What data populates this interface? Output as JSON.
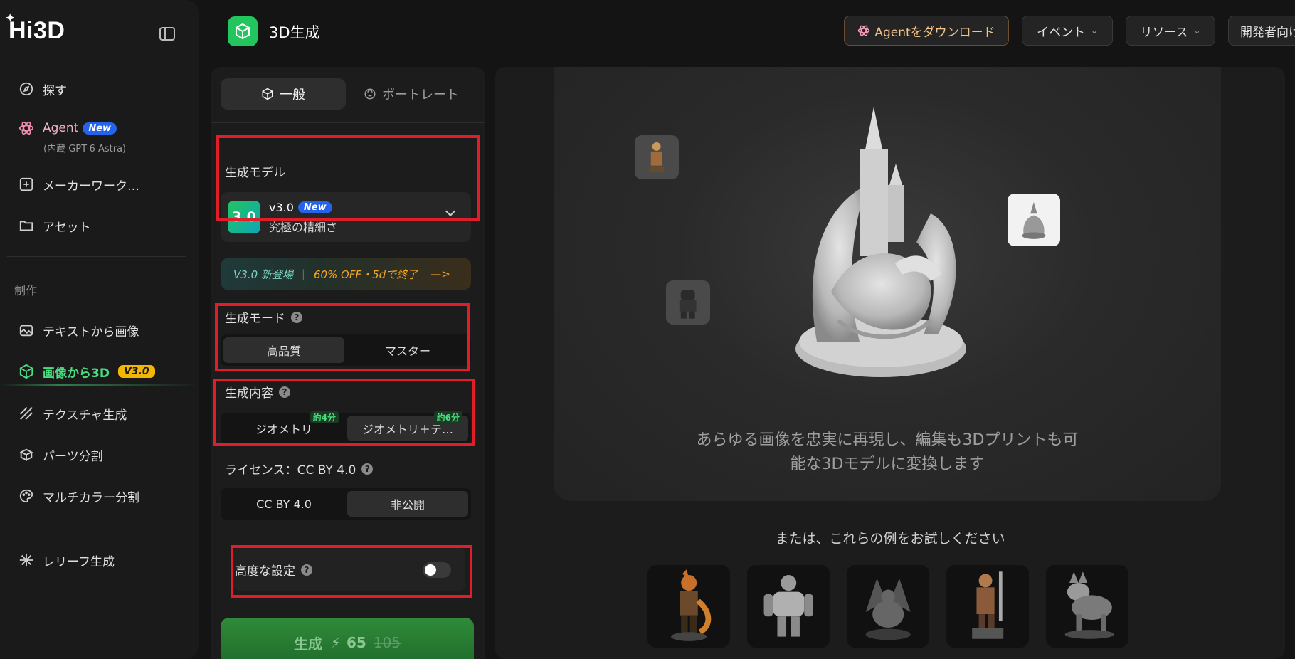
{
  "app": {
    "logo": "Hi3D"
  },
  "sidebar": {
    "items": [
      {
        "label": "探す",
        "icon": "compass-icon"
      },
      {
        "label": "Agent",
        "badge": "New",
        "sub": "(内蔵 GPT-6 Astra)",
        "icon": "atom-icon"
      },
      {
        "label": "メーカーワーク…",
        "icon": "workspace-icon"
      },
      {
        "label": "アセット",
        "icon": "folder-icon"
      }
    ],
    "section_label": "制作",
    "create_items": [
      {
        "label": "テキストから画像",
        "icon": "image-sparkle-icon"
      },
      {
        "label": "画像から3D",
        "badge": "V3.0",
        "icon": "cube-icon",
        "active": true
      },
      {
        "label": "テクスチャ生成",
        "icon": "texture-icon"
      },
      {
        "label": "パーツ分割",
        "icon": "parts-icon"
      },
      {
        "label": "マルチカラー分割",
        "icon": "palette-icon"
      }
    ],
    "relief": {
      "label": "レリーフ生成",
      "icon": "relief-icon"
    }
  },
  "header": {
    "title": "3D生成",
    "buttons": [
      {
        "label": "Agentをダウンロード"
      },
      {
        "label": "イベント"
      },
      {
        "label": "リソース"
      },
      {
        "label": "開発者向け"
      }
    ]
  },
  "panel": {
    "tabs": [
      {
        "label": "一般"
      },
      {
        "label": "ポートレート"
      }
    ],
    "model": {
      "label": "生成モデル",
      "badge": "3.0",
      "version": "v3.0",
      "new_badge": "New",
      "desc": "究極の精細さ"
    },
    "promo": {
      "left": "V3.0 新登場",
      "right": "60% OFF・5dで終了",
      "arrow": "—>"
    },
    "mode": {
      "label": "生成モード",
      "options": [
        "高品質",
        "マスター"
      ],
      "selected": "高品質"
    },
    "content": {
      "label": "生成内容",
      "options": [
        {
          "label": "ジオメトリ",
          "time": "約4分"
        },
        {
          "label": "ジオメトリ＋テ…",
          "time": "約6分"
        }
      ],
      "selected": "ジオメトリ＋テ…"
    },
    "license": {
      "label": "ライセンス：CC BY 4.0",
      "options": [
        "CC BY 4.0",
        "非公開"
      ],
      "selected": "非公開"
    },
    "advanced": {
      "label": "高度な設定",
      "enabled": false
    },
    "generate": {
      "label": "生成",
      "cost": "65",
      "old_cost": "105"
    }
  },
  "main": {
    "description_lines": [
      "あらゆる画像を忠実に再現し、編集も3Dプリントも可",
      "能な3Dモデルに変換します"
    ],
    "examples_title": "または、これらの例をお試しください"
  },
  "colors": {
    "accent_green": "#4ade80",
    "highlight_red": "#e11d2a",
    "promo_orange": "#f5a524"
  }
}
